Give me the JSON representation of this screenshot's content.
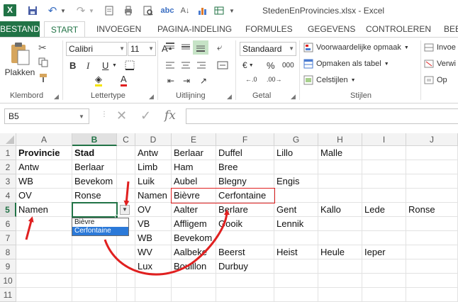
{
  "window": {
    "title": "StedenEnProvincies.xlsx - Excel"
  },
  "tabs": [
    {
      "id": "file",
      "label": "BESTAND"
    },
    {
      "id": "start",
      "label": "START"
    },
    {
      "id": "insert",
      "label": "INVOEGEN"
    },
    {
      "id": "layout",
      "label": "PAGINA-INDELING"
    },
    {
      "id": "formulas",
      "label": "FORMULES"
    },
    {
      "id": "data",
      "label": "GEGEVENS"
    },
    {
      "id": "review",
      "label": "CONTROLEREN"
    },
    {
      "id": "view",
      "label": "BEE"
    }
  ],
  "ribbon": {
    "paste_label": "Plakken",
    "clipboard_label": "Klembord",
    "font_name": "Calibri",
    "font_size": "11",
    "bold": "B",
    "italic": "I",
    "underline": "U",
    "font_group_label": "Lettertype",
    "alignment_label": "Uitlijning",
    "number_format": "Standaard",
    "currency": "€",
    "percent": "%",
    "thousands": "000",
    "number_label": "Getal",
    "conditional": "Voorwaardelijke opmaak",
    "format_table": "Opmaken als tabel",
    "cell_styles": "Celstijlen",
    "styles_label": "Stijlen",
    "insert_partial": "Invoe",
    "delete_partial": "Verwi",
    "format_partial": "Op"
  },
  "formula_bar": {
    "name_box": "B5",
    "fx": "fx"
  },
  "grid": {
    "columns": [
      "A",
      "B",
      "C",
      "D",
      "E",
      "F",
      "G",
      "H",
      "I",
      "J"
    ],
    "rows": [
      "1",
      "2",
      "3",
      "4",
      "5",
      "6",
      "7",
      "8",
      "9",
      "10",
      "11"
    ],
    "cells": {
      "A1": "Provincie",
      "B1": "Stad",
      "D1": "Antw",
      "E1": "Berlaar",
      "F1": "Duffel",
      "G1": "Lillo",
      "H1": "Malle",
      "A2": "Antw",
      "B2": "Berlaar",
      "D2": "Limb",
      "E2": "Ham",
      "F2": "Bree",
      "A3": "WB",
      "B3": "Bevekom",
      "D3": "Luik",
      "E3": "Aubel",
      "F3": "Blegny",
      "G3": "Engis",
      "A4": "OV",
      "B4": "Ronse",
      "D4": "Namen",
      "E4": "Bièvre",
      "F4": "Cerfontaine",
      "A5": "Namen",
      "D5": "OV",
      "E5": "Aalter",
      "F5": "Berlare",
      "G5": "Gent",
      "H5": "Kallo",
      "I5": "Lede",
      "J5": "Ronse",
      "D6": "VB",
      "E6": "Affligem",
      "F6": "Gooik",
      "G6": "Lennik",
      "D7": "WB",
      "E7": "Bevekom",
      "D8": "WV",
      "E8": "Aalbeke",
      "F8": "Beerst",
      "G8": "Heist",
      "H8": "Heule",
      "I8": "Ieper",
      "D9": "Lux",
      "E9": "Bouillon",
      "F9": "Durbuy"
    },
    "dropdown_items": [
      "Bièvre",
      "Cerfontaine"
    ]
  },
  "colors": {
    "excel_green": "#217346",
    "annotation_red": "#e02020",
    "dropdown_select": "#2b79d8"
  }
}
